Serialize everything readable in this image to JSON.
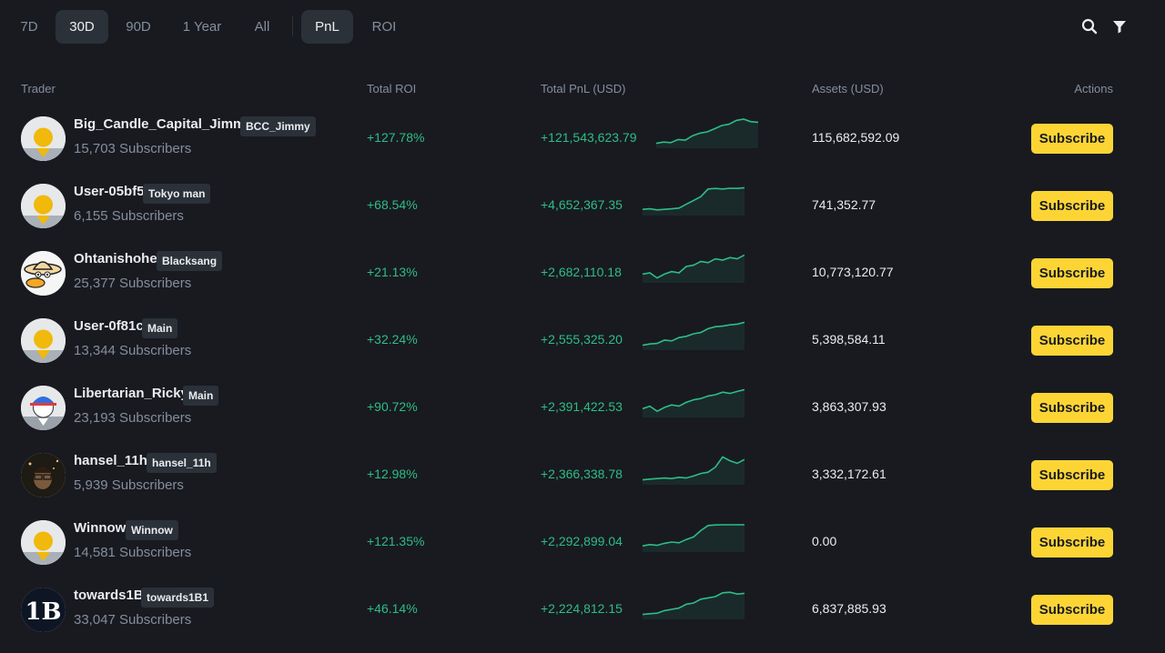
{
  "periods": [
    "7D",
    "30D",
    "90D",
    "1 Year",
    "All"
  ],
  "active_period": "30D",
  "metrics": [
    "PnL",
    "ROI"
  ],
  "active_metric": "PnL",
  "icons": {
    "search": "search-icon",
    "filter": "filter-icon"
  },
  "colors": {
    "background": "#181a20",
    "positive": "#2ebd85",
    "negative": "#f6465d",
    "accent": "#fcd535",
    "muted": "#848e9c"
  },
  "table": {
    "headers": {
      "trader": "Trader",
      "roi": "Total ROI",
      "pnl": "Total PnL (USD)",
      "assets": "Assets (USD)",
      "actions": "Actions"
    },
    "subscribe_label": "Subscribe",
    "rows": [
      {
        "name": "Big_Candle_Capital_Jimmy",
        "tag": "BCC_Jimmy",
        "subscribers": "15,703 Subscribers",
        "roi": "+127.78%",
        "pnl": "+121,543,623.79",
        "assets": "115,682,592.09",
        "avatar": "default-avatar",
        "trend": [
          0.05,
          0.1,
          0.08,
          0.2,
          0.18,
          0.35,
          0.45,
          0.5,
          0.62,
          0.75,
          0.8,
          0.95,
          1.0,
          0.9,
          0.88
        ]
      },
      {
        "name": "User-05bf5",
        "tag": "Tokyo man",
        "subscribers": "6,155 Subscribers",
        "roi": "+68.54%",
        "pnl": "+4,652,367.35",
        "assets": "741,352.77",
        "avatar": "default-avatar",
        "trend": [
          0.1,
          0.12,
          0.08,
          0.1,
          0.12,
          0.15,
          0.3,
          0.45,
          0.6,
          0.9,
          0.92,
          0.9,
          0.93,
          0.92,
          0.95
        ]
      },
      {
        "name": "Ohtanishohei",
        "tag": "Blacksang",
        "subscribers": "25,377 Subscribers",
        "roi": "+21.13%",
        "pnl": "+2,682,110.18",
        "assets": "10,773,120.77",
        "avatar": "duck-avatar",
        "trend": [
          0.2,
          0.25,
          0.05,
          0.2,
          0.3,
          0.25,
          0.5,
          0.55,
          0.7,
          0.65,
          0.8,
          0.75,
          0.85,
          0.8,
          0.95
        ]
      },
      {
        "name": "User-0f81c",
        "tag": "Main",
        "subscribers": "13,344 Subscribers",
        "roi": "+32.24%",
        "pnl": "+2,555,325.20",
        "assets": "5,398,584.11",
        "avatar": "default-avatar",
        "trend": [
          0.05,
          0.1,
          0.12,
          0.25,
          0.22,
          0.35,
          0.4,
          0.5,
          0.55,
          0.7,
          0.78,
          0.8,
          0.85,
          0.88,
          0.95
        ]
      },
      {
        "name": "Libertarian_Ricky",
        "tag": "Main",
        "subscribers": "23,193 Subscribers",
        "roi": "+90.72%",
        "pnl": "+2,391,422.53",
        "assets": "3,863,307.93",
        "avatar": "blue-cap-avatar",
        "trend": [
          0.2,
          0.3,
          0.1,
          0.25,
          0.35,
          0.3,
          0.45,
          0.55,
          0.6,
          0.7,
          0.75,
          0.85,
          0.8,
          0.88,
          0.95
        ]
      },
      {
        "name": "hansel_11h",
        "tag": "hansel_11h",
        "subscribers": "5,939 Subscribers",
        "roi": "+12.98%",
        "pnl": "+2,366,338.78",
        "assets": "3,332,172.61",
        "avatar": "photo-avatar",
        "trend": [
          0.05,
          0.08,
          0.1,
          0.12,
          0.1,
          0.15,
          0.12,
          0.2,
          0.3,
          0.35,
          0.55,
          0.95,
          0.8,
          0.7,
          0.85
        ]
      },
      {
        "name": "Winnow",
        "tag": "Winnow",
        "subscribers": "14,581 Subscribers",
        "roi": "+121.35%",
        "pnl": "+2,292,899.04",
        "assets": "0.00",
        "avatar": "default-avatar",
        "trend": [
          0.1,
          0.15,
          0.12,
          0.2,
          0.25,
          0.22,
          0.35,
          0.45,
          0.7,
          0.9,
          0.92,
          0.93,
          0.93,
          0.93,
          0.93
        ]
      },
      {
        "name": "towards1B",
        "tag": "towards1B1",
        "subscribers": "33,047 Subscribers",
        "roi": "+46.14%",
        "pnl": "+2,224,812.15",
        "assets": "6,837,885.93",
        "avatar": "1b-logo-avatar",
        "trend": [
          0.05,
          0.08,
          0.1,
          0.2,
          0.25,
          0.3,
          0.45,
          0.5,
          0.65,
          0.7,
          0.75,
          0.9,
          0.92,
          0.85,
          0.88
        ]
      }
    ]
  }
}
